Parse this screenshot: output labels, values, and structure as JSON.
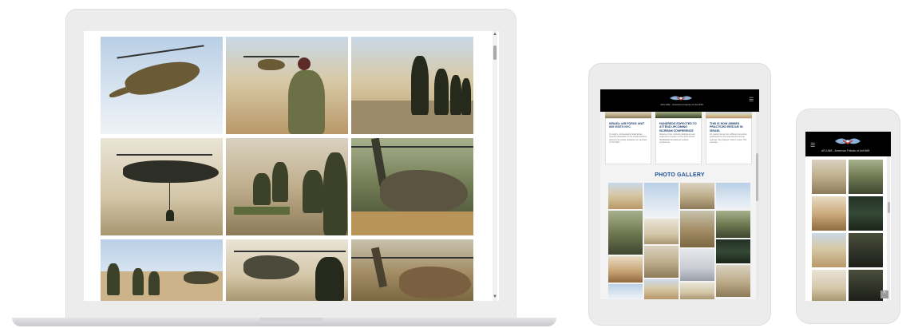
{
  "tablet": {
    "news": [
      {
        "title": "ISRAELI AIR FORCE UNIT 669 VISITS NYC",
        "text": "On April 1, Ambassador Gilad Erdan, Israeli Ambassador to the United Nations, opened his private residence to members of Unit 669..."
      },
      {
        "title": "HUNDREDS EXPECTED TO ATTEND UPCOMING ISCREAM CONFERENCE",
        "text": "Dozens of top medical practitioners are expected to present at the third annual ISCREAM international medical conference..."
      },
      {
        "title": "THIS IS HOW ARMIES PRACTICED RESCUE IN ISRAEL",
        "text": "Air rescue forces from different countries participated in the international rescue exercise 'Sky Reaper' held in Israel. The exercise..."
      }
    ],
    "gallery_title": "PHOTO GALLERY",
    "tagline": "AFU-669 · American Friends of Unit 669",
    "menu_icon": "hamburger-icon"
  },
  "phone": {
    "tagline": "AFU-669 - American Friends of Unit 669",
    "menu_icon": "hamburger-icon",
    "top_button_icon": "chevron-up-icon"
  },
  "laptop": {
    "scroll_up_icon": "triangle-up-icon",
    "scroll_down_icon": "triangle-down-icon"
  },
  "colors": {
    "header_bg": "#000000",
    "gallery_title": "#1b4f8f",
    "news_title": "#1a3c6e"
  }
}
